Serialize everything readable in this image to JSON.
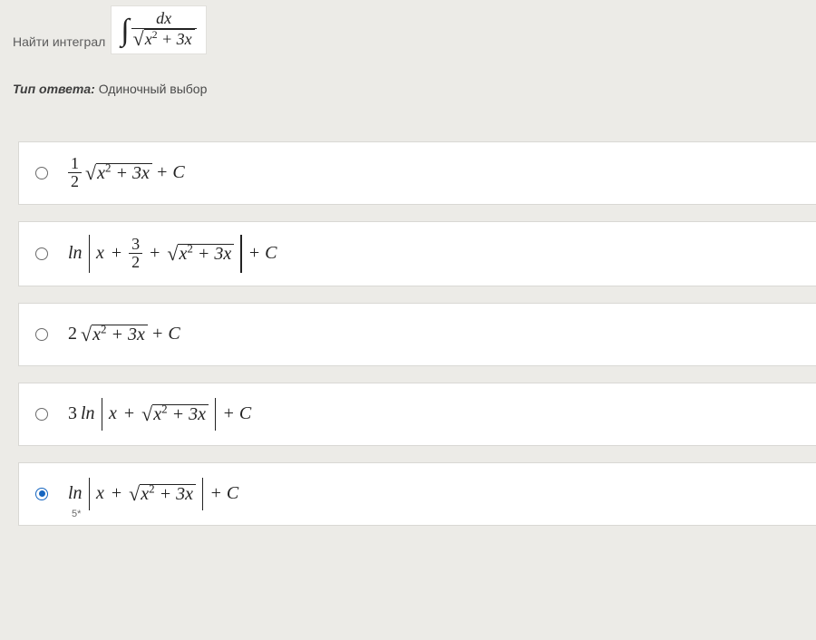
{
  "question": {
    "prefix": "Найти интеграл",
    "integral": {
      "numer": "dx",
      "radicand_main": "x",
      "radicand_exp": "2",
      "radicand_tail": "+ 3x"
    }
  },
  "answer_type": {
    "label": "Тип ответа:",
    "value": "Одиночный выбор"
  },
  "options": [
    {
      "id": "opt1",
      "selected": false,
      "frac_num": "1",
      "frac_den": "2",
      "rad_main": "x",
      "rad_exp": "2",
      "rad_tail": "+ 3x",
      "tail": "+ C"
    },
    {
      "id": "opt2",
      "selected": false,
      "ln": "ln",
      "p1": "x",
      "plus1": "+",
      "frac_num": "3",
      "frac_den": "2",
      "plus2": "+",
      "rad_main": "x",
      "rad_exp": "2",
      "rad_tail": "+ 3x",
      "tail": "+ C"
    },
    {
      "id": "opt3",
      "selected": false,
      "coef": "2",
      "rad_main": "x",
      "rad_exp": "2",
      "rad_tail": "+ 3x",
      "tail": "+ C"
    },
    {
      "id": "opt4",
      "selected": false,
      "coef": "3",
      "ln": "ln",
      "p1": "x",
      "plus1": "+",
      "rad_main": "x",
      "rad_exp": "2",
      "rad_tail": "+ 3x",
      "tail": "+ C"
    },
    {
      "id": "opt5",
      "selected": true,
      "ln": "ln",
      "p1": "x",
      "plus1": "+",
      "rad_main": "x",
      "rad_exp": "2",
      "rad_tail": "+ 3x",
      "tail": "+ C",
      "footnote": "5*"
    }
  ]
}
